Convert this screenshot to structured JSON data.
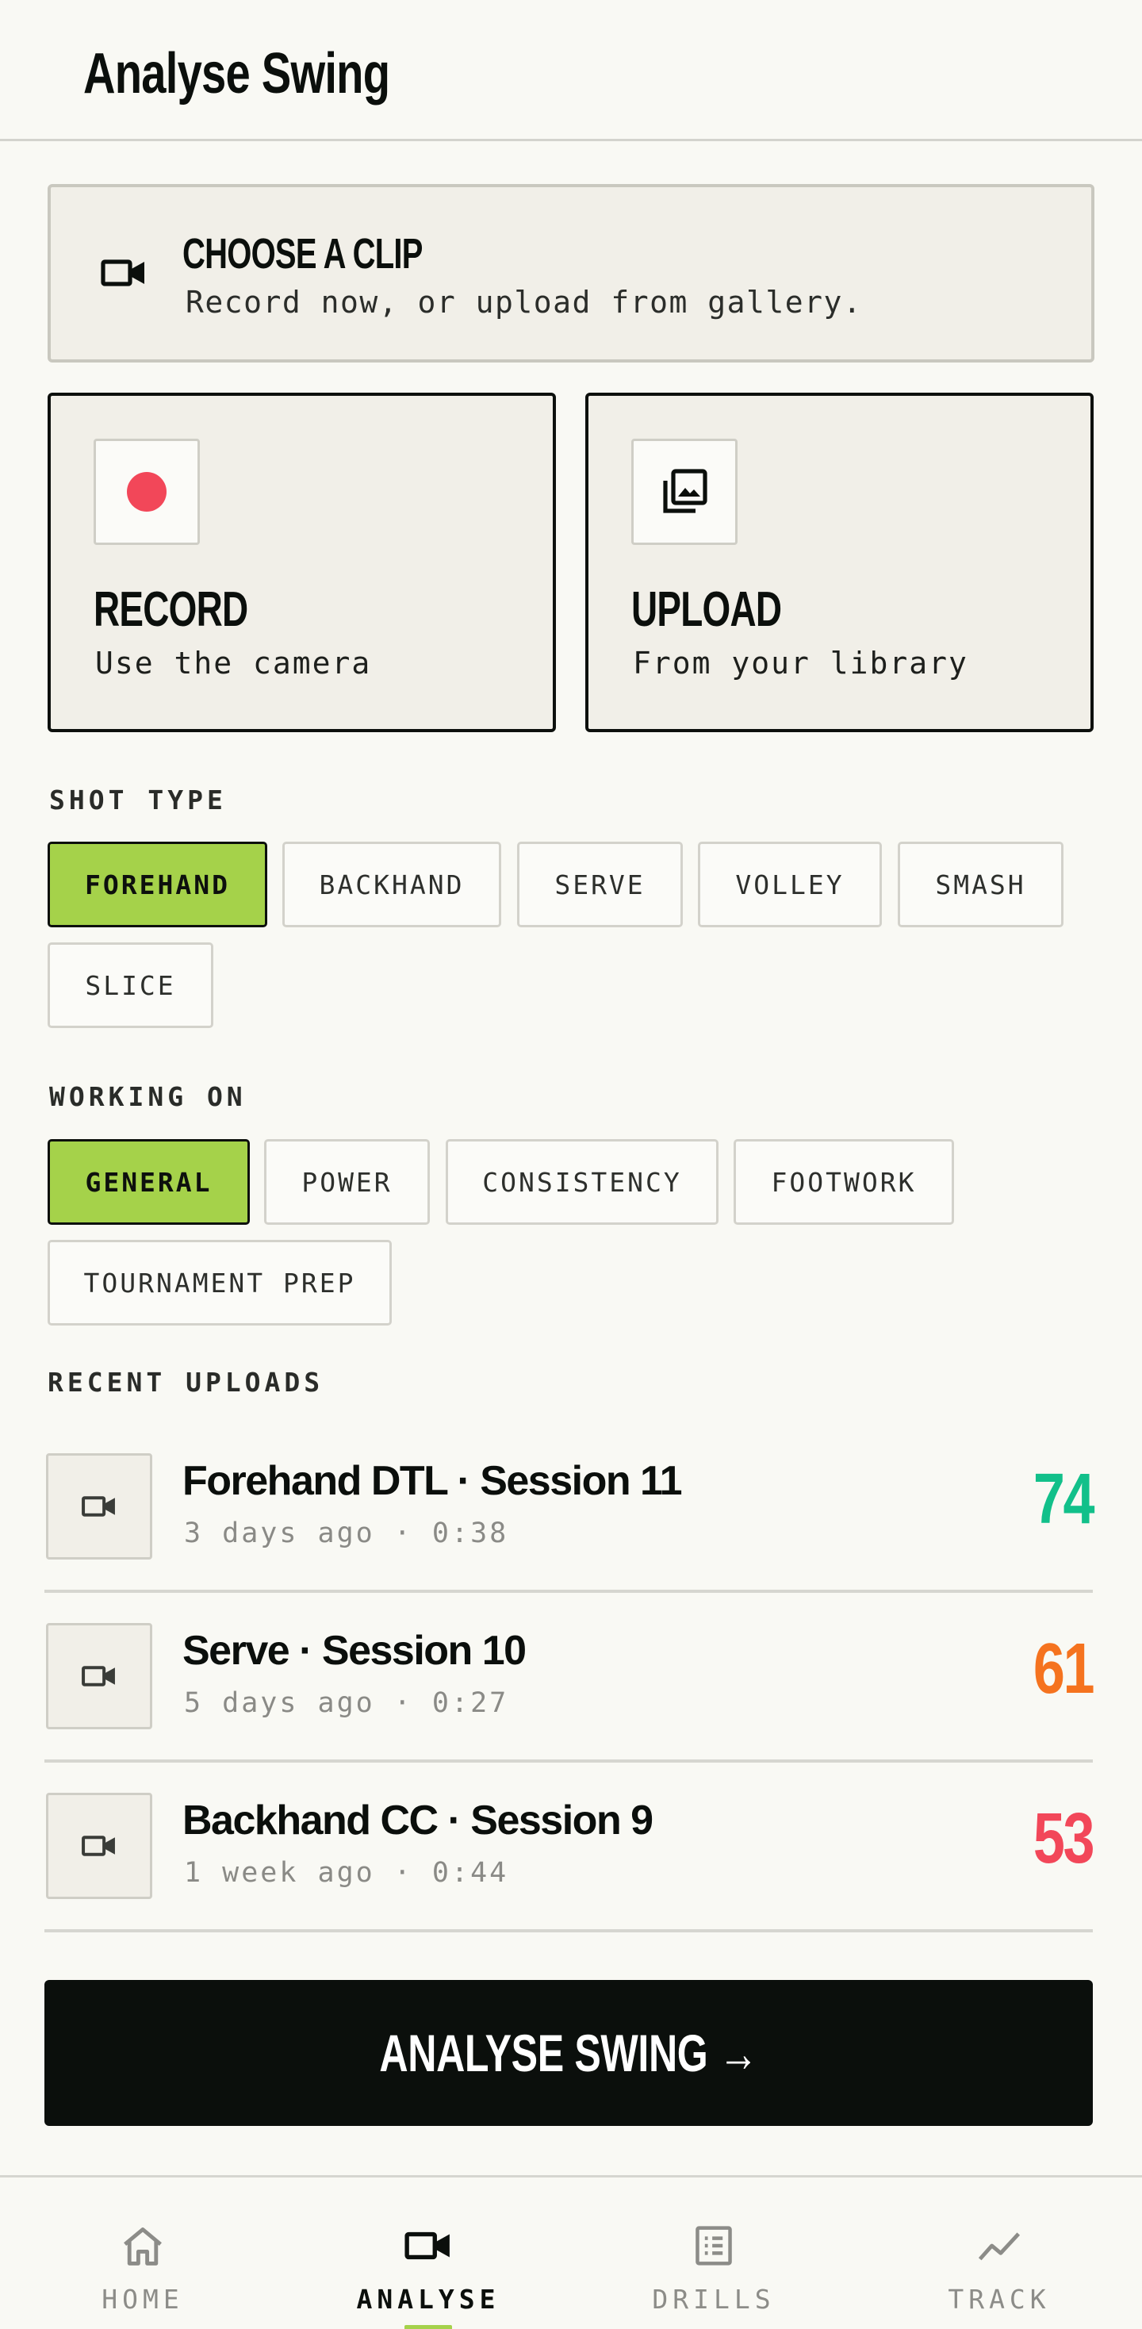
{
  "header": {
    "title": "Analyse Swing"
  },
  "clip_banner": {
    "title": "CHOOSE A CLIP",
    "subtitle": "Record now, or upload from gallery."
  },
  "source_cards": {
    "record": {
      "title": "RECORD",
      "subtitle": "Use the camera"
    },
    "upload": {
      "title": "UPLOAD",
      "subtitle": "From your library"
    }
  },
  "shot_type": {
    "label": "SHOT TYPE",
    "options": [
      "FOREHAND",
      "BACKHAND",
      "SERVE",
      "VOLLEY",
      "SMASH",
      "SLICE"
    ],
    "selected": "FOREHAND"
  },
  "working_on": {
    "label": "WORKING ON",
    "options": [
      "GENERAL",
      "POWER",
      "CONSISTENCY",
      "FOOTWORK",
      "TOURNAMENT PREP"
    ],
    "selected": "GENERAL"
  },
  "recent_uploads": {
    "label": "RECENT UPLOADS",
    "items": [
      {
        "title": "Forehand DTL · Session 11",
        "meta": "3 days ago · 0:38",
        "score": "74",
        "score_color": "#12c08a"
      },
      {
        "title": "Serve · Session 10",
        "meta": "5 days ago · 0:27",
        "score": "61",
        "score_color": "#f5731f"
      },
      {
        "title": "Backhand CC · Session 9",
        "meta": "1 week ago · 0:44",
        "score": "53",
        "score_color": "#f24759"
      }
    ]
  },
  "cta": {
    "label": "ANALYSE SWING →"
  },
  "nav": {
    "items": [
      {
        "label": "HOME",
        "icon": "home-icon"
      },
      {
        "label": "ANALYSE",
        "icon": "video-camera-icon",
        "active": true
      },
      {
        "label": "DRILLS",
        "icon": "list-icon"
      },
      {
        "label": "TRACK",
        "icon": "trend-line-icon"
      }
    ]
  },
  "colors": {
    "accent": "#a5d24a",
    "record": "#f24759",
    "ink": "#0b0f0c",
    "background": "#f9f9f4"
  }
}
